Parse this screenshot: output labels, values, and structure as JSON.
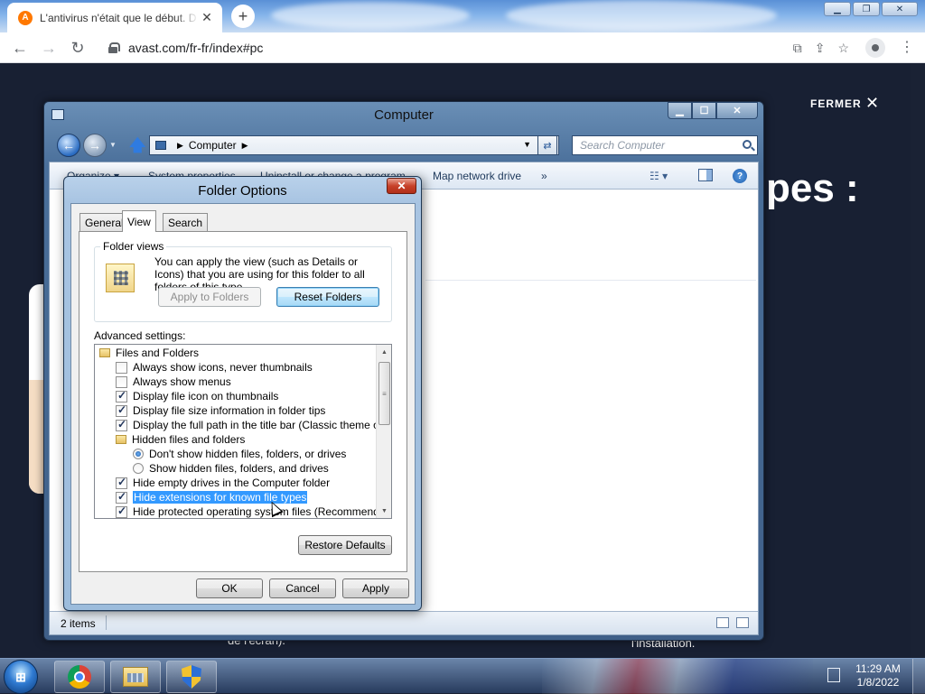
{
  "browser": {
    "tab_title": "L'antivirus n'était que le début. D",
    "favicon_letter": "A",
    "url": "avast.com/fr-fr/index#pc"
  },
  "webpage": {
    "close_label": "FERMER",
    "headline_fragment": "pes :",
    "bottom_text_left": "de l'écran).",
    "bottom_text_right": "l'installation."
  },
  "explorer": {
    "title": "Computer",
    "address_location": "Computer",
    "search_placeholder": "Search Computer",
    "commands": {
      "organize": "Organize ▾",
      "system_properties": "System properties",
      "uninstall": "Uninstall or change a program",
      "map_drive": "Map network drive",
      "more": "»"
    },
    "status_count": "2 items"
  },
  "dialog": {
    "title": "Folder Options",
    "tabs": [
      "General",
      "View",
      "Search"
    ],
    "active_tab": "View",
    "folder_views": {
      "label": "Folder views",
      "description": "You can apply the view (such as Details or Icons) that you are using for this folder to all folders of this type.",
      "apply_button": "Apply to Folders",
      "reset_button": "Reset Folders"
    },
    "advanced_label": "Advanced settings:",
    "tree_items": [
      {
        "type": "folder",
        "label": "Files and Folders",
        "indent": 0
      },
      {
        "type": "checkbox",
        "checked": false,
        "label": "Always show icons, never thumbnails",
        "indent": 1
      },
      {
        "type": "checkbox",
        "checked": false,
        "label": "Always show menus",
        "indent": 1
      },
      {
        "type": "checkbox",
        "checked": true,
        "label": "Display file icon on thumbnails",
        "indent": 1
      },
      {
        "type": "checkbox",
        "checked": true,
        "label": "Display file size information in folder tips",
        "indent": 1
      },
      {
        "type": "checkbox",
        "checked": true,
        "label": "Display the full path in the title bar (Classic theme only)",
        "indent": 1
      },
      {
        "type": "folder",
        "label": "Hidden files and folders",
        "indent": 1
      },
      {
        "type": "radio",
        "checked": true,
        "label": "Don't show hidden files, folders, or drives",
        "indent": 2
      },
      {
        "type": "radio",
        "checked": false,
        "label": "Show hidden files, folders, and drives",
        "indent": 2
      },
      {
        "type": "checkbox",
        "checked": true,
        "label": "Hide empty drives in the Computer folder",
        "indent": 1
      },
      {
        "type": "checkbox",
        "checked": true,
        "label": "Hide extensions for known file types",
        "indent": 1,
        "selected": true
      },
      {
        "type": "checkbox",
        "checked": true,
        "label": "Hide protected operating system files (Recommended)",
        "indent": 1
      }
    ],
    "restore_defaults": "Restore Defaults",
    "ok": "OK",
    "cancel": "Cancel",
    "apply": "Apply"
  },
  "taskbar": {
    "time": "11:29 AM",
    "date": "1/8/2022"
  }
}
